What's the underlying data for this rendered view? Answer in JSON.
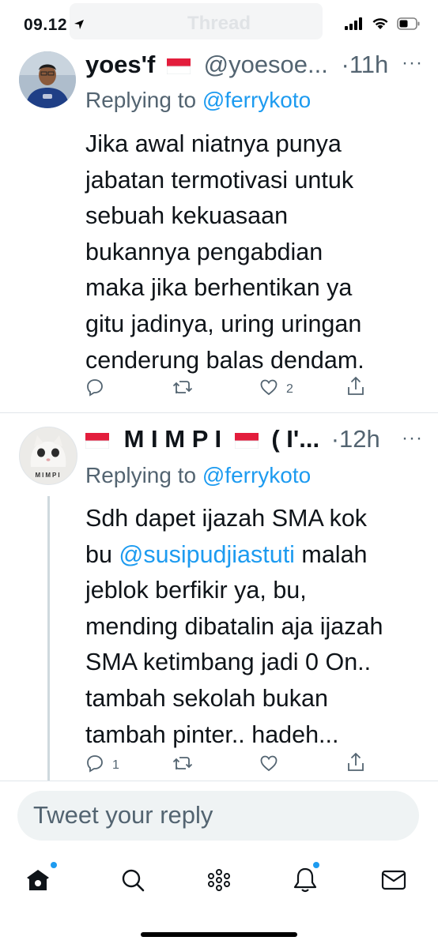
{
  "status": {
    "time": "09.12"
  },
  "header": {
    "title": "Thread"
  },
  "tweets": [
    {
      "name": "yoes'f",
      "handle": "@yoesoe...",
      "time": "·11h",
      "replying_prefix": "Replying to ",
      "replying_to": "@ferrykoto",
      "text": "Jika awal niatnya punya\njabatan termotivasi untuk\nsebuah kekuasaan\nbukannya pengabdian\nmaka jika berhentikan ya\ngitu jadinya, uring uringan\ncenderung balas dendam.",
      "likes": "2"
    },
    {
      "name": "M I M P I",
      "name_tail": "( I'...",
      "time": "·12h",
      "avatar_label": "MIMPI",
      "replying_prefix": "Replying to ",
      "replying_to": "@ferrykoto",
      "text_a": "Sdh dapet ijazah SMA kok\nbu ",
      "mention": "@susipudjiastuti",
      "text_b": " malah\njeblok berfikir ya, bu,\nmending dibatalin aja ijazah\nSMA ketimbang jadi 0 On..\ntambah sekolah bukan\ntambah pinter.. hadeh...",
      "replies": "1"
    }
  ],
  "reply_bar": {
    "placeholder": "Tweet your reply"
  },
  "colors": {
    "accent": "#1d9bf0",
    "secondary": "#536471",
    "flag_red": "#e31d3c"
  },
  "icons": [
    "navigation-arrow-icon",
    "signal-icon",
    "wifi-icon",
    "battery-icon",
    "more-icon",
    "reply-icon",
    "retweet-icon",
    "like-icon",
    "share-icon",
    "home-icon",
    "search-icon",
    "spaces-icon",
    "notifications-icon",
    "messages-icon"
  ]
}
